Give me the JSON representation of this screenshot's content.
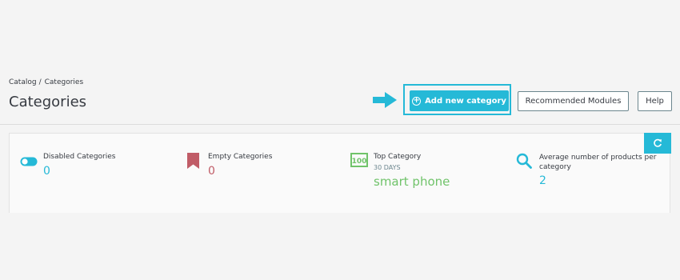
{
  "breadcrumb": {
    "items": [
      "Catalog",
      "Categories"
    ],
    "separator": "/"
  },
  "page": {
    "title": "Categories"
  },
  "toolbar": {
    "add_label": "Add new category",
    "modules_label": "Recommended Modules",
    "help_label": "Help"
  },
  "kpis": {
    "disabled": {
      "label": "Disabled Categories",
      "value": "0"
    },
    "empty": {
      "label": "Empty Categories",
      "value": "0"
    },
    "top": {
      "label": "Top Category",
      "sub": "30 DAYS",
      "value": "smart phone",
      "icon_text": "100"
    },
    "average": {
      "label": "Average number of products per category",
      "value": "2"
    }
  },
  "colors": {
    "accent": "#25b9d7",
    "danger": "#c05c67",
    "success": "#70c36a",
    "text": "#363a41"
  },
  "icons": {
    "toggle": "toggle-icon",
    "bookmark": "bookmark-icon",
    "badge": "badge-100-icon",
    "search": "search-icon",
    "refresh": "refresh-icon",
    "arrow": "arrow-right-icon",
    "plus": "plus-circle-icon"
  }
}
